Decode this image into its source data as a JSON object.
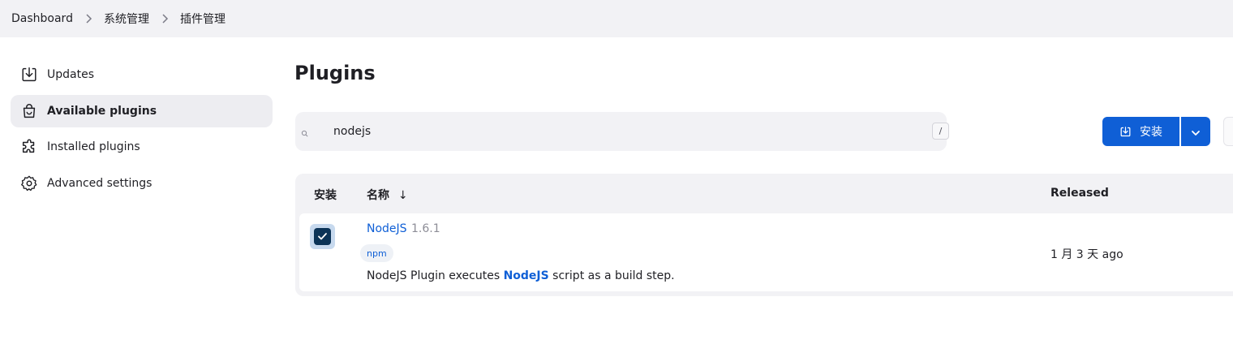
{
  "breadcrumb": {
    "items": [
      "Dashboard",
      "系统管理",
      "插件管理"
    ]
  },
  "sidebar": {
    "items": [
      {
        "label": "Updates",
        "icon": "download-icon"
      },
      {
        "label": "Available plugins",
        "icon": "shopping-bag-icon",
        "active": true
      },
      {
        "label": "Installed plugins",
        "icon": "puzzle-icon"
      },
      {
        "label": "Advanced settings",
        "icon": "gear-icon"
      }
    ]
  },
  "main": {
    "title": "Plugins",
    "search": {
      "value": "nodejs",
      "shortcut": "/"
    },
    "install_button": {
      "label": "安装",
      "icon": "download-icon"
    },
    "accent_color": "#0f5fd6"
  },
  "table": {
    "headers": {
      "install": "安装",
      "name": "名称",
      "name_sort": "↓",
      "released": "Released"
    },
    "rows": [
      {
        "checked": true,
        "name": "NodeJS",
        "version": "1.6.1",
        "tag": "npm",
        "excerpt_pre": "NodeJS Plugin executes ",
        "excerpt_link": "NodeJS",
        "excerpt_post": " script as a build step.",
        "released": "1 月 3 天 ago"
      }
    ]
  }
}
